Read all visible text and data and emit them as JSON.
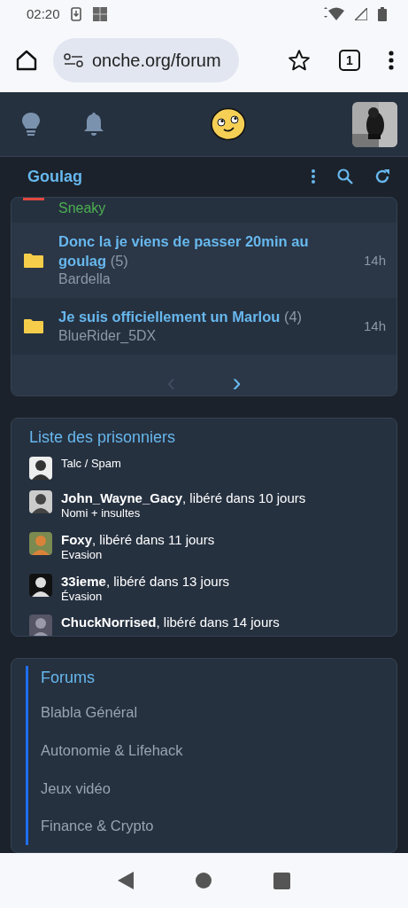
{
  "status_bar": {
    "time": "02:20"
  },
  "browser": {
    "url": "onche.org/forum",
    "tab_count": "1"
  },
  "section": {
    "title": "Goulag"
  },
  "topics": [
    {
      "kind": "partial",
      "author": "Sneaky",
      "color": "#4caf50"
    },
    {
      "kind": "topic",
      "title": "Donc la je viens de passer 20min au goulag",
      "count": "(5)",
      "author": "Bardella",
      "color": "#8b98a8",
      "time": "14h"
    },
    {
      "kind": "topic",
      "title": "Je suis officiellement un Marlou",
      "count": "(4)",
      "author": "BlueRider_5DX",
      "color": "#8b98a8",
      "time": "14h"
    }
  ],
  "pagination": {
    "prev": {
      "label": "‹",
      "disabled": true
    },
    "next": {
      "label": "›",
      "disabled": false
    }
  },
  "prisoners": {
    "title": "Liste des prisonniers",
    "items": [
      {
        "reason": "Talc / Spam"
      },
      {
        "line": "**John_Wayne_Gacy**, libéré dans 10 jours",
        "reason": "Nomi + insultes"
      },
      {
        "line": "**Foxy**, libéré dans 11 jours",
        "reason": "Evasion"
      },
      {
        "line": "**33ieme**, libéré dans 13 jours",
        "reason": "Évasion"
      },
      {
        "line": "**ChuckNorrised**, libéré dans 14 jours"
      }
    ]
  },
  "forums": {
    "title": "Forums",
    "items": [
      "Blabla Général",
      "Autonomie & Lifehack",
      "Jeux vidéo",
      "Finance & Crypto"
    ]
  }
}
